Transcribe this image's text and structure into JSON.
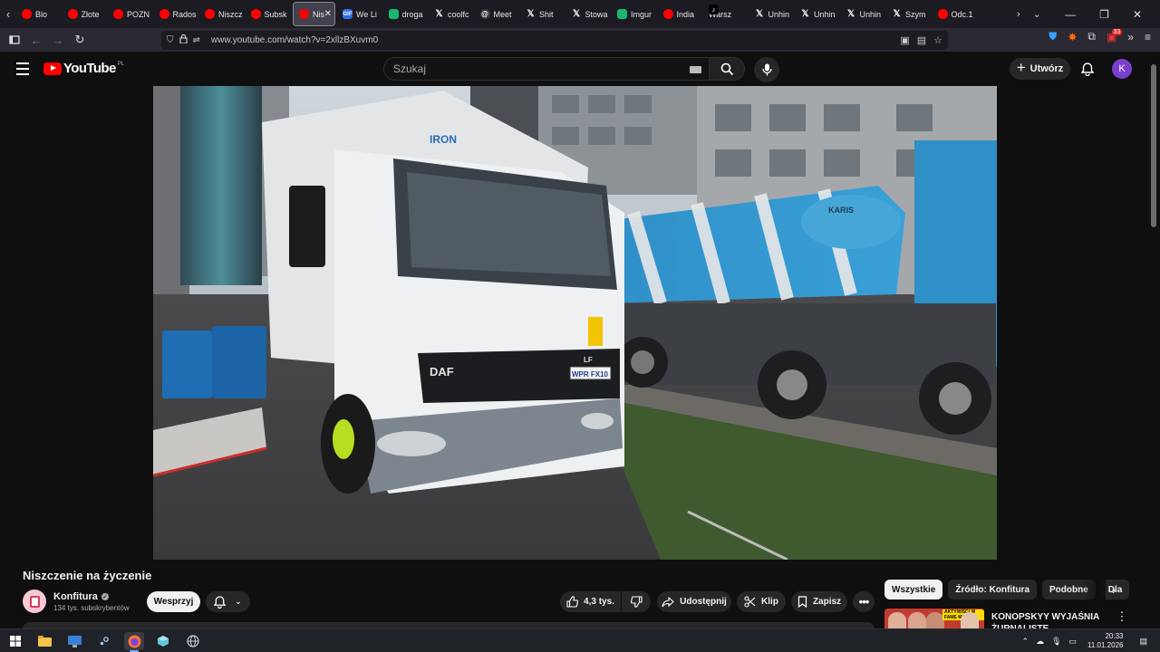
{
  "browser": {
    "tabs": [
      {
        "title": "Blo",
        "icon": "youtube-icon"
      },
      {
        "title": "Złote",
        "icon": "youtube-icon"
      },
      {
        "title": "POZN",
        "icon": "youtube-icon"
      },
      {
        "title": "Rados",
        "icon": "youtube-icon"
      },
      {
        "title": "Niszcz",
        "icon": "youtube-icon"
      },
      {
        "title": "Subsk",
        "icon": "youtube-icon"
      },
      {
        "title": "Nis",
        "icon": "youtube-icon",
        "active": true
      },
      {
        "title": "We Li",
        "icon": "gif-icon"
      },
      {
        "title": "droga",
        "icon": "green-icon"
      },
      {
        "title": "coolfc",
        "icon": "x-icon"
      },
      {
        "title": "Meet",
        "icon": "threads-icon"
      },
      {
        "title": "Shit",
        "icon": "x-icon"
      },
      {
        "title": "Stowa",
        "icon": "x-icon"
      },
      {
        "title": "Imgur",
        "icon": "green-icon"
      },
      {
        "title": "India",
        "icon": "youtube-icon"
      },
      {
        "title": "Warsz",
        "icon": "tiktok-icon"
      },
      {
        "title": "Unhin",
        "icon": "x-icon"
      },
      {
        "title": "Unhin",
        "icon": "x-icon"
      },
      {
        "title": "Unhin",
        "icon": "x-icon"
      },
      {
        "title": "Szym",
        "icon": "x-icon"
      },
      {
        "title": "Odc.1",
        "icon": "youtube-icon"
      }
    ],
    "url": "www.youtube.com/watch?v=2xllzBXuvm0",
    "extension_badge": "33"
  },
  "youtube": {
    "logo_text": "YouTube",
    "country_code": "PL",
    "search_placeholder": "Szukaj",
    "create_label": "Utwórz",
    "avatar_letter": "K"
  },
  "video": {
    "title": "Niszczenie na życzenie",
    "channel_name": "Konfitura",
    "subscribers": "134 tys. subskrybentów",
    "support_label": "Wesprzyj",
    "likes": "4,3 tys.",
    "share_label": "Udostępnij",
    "clip_label": "Klip",
    "save_label": "Zapisz"
  },
  "scene": {
    "truck_brand": "DAF",
    "truck_cab_text": "LF",
    "truck_plate": "WPR FX10",
    "box_logo": "IRON",
    "mixer_text": "KARIS"
  },
  "sidebar": {
    "chips": [
      "Wszystkie",
      "Źródło: Konfitura",
      "Podobne",
      "Dla"
    ],
    "recommendation_title": "KONOPSKYY WYJAŚNIA ŻURNALISTE",
    "thumb_banner": "AKTYWIŚCI W FAME MMA?"
  },
  "taskbar": {
    "time": "20:33",
    "date": "11.01.2026"
  }
}
